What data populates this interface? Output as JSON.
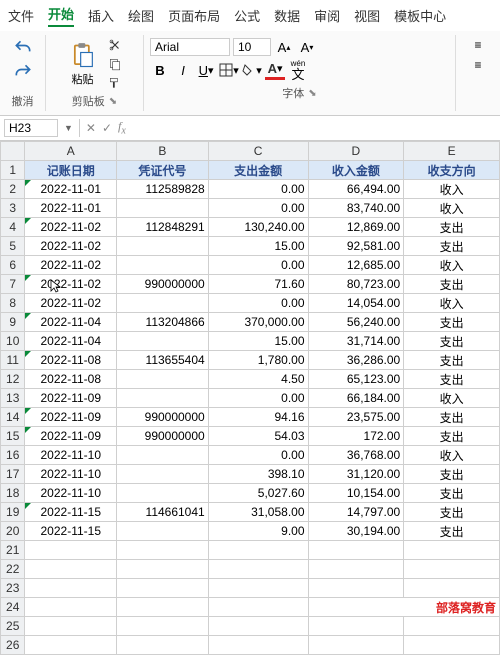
{
  "menu": {
    "items": [
      "文件",
      "开始",
      "插入",
      "绘图",
      "页面布局",
      "公式",
      "数据",
      "审阅",
      "视图",
      "模板中心"
    ],
    "active": 1
  },
  "ribbon": {
    "undo_label": "撤消",
    "clipboard_label": "剪贴板",
    "paste_label": "粘贴",
    "font_label": "字体",
    "font_name": "Arial",
    "font_size": "10",
    "wen_label": "wén",
    "wen_sub": "文"
  },
  "namebox": {
    "ref": "H23"
  },
  "columns": [
    "A",
    "B",
    "C",
    "D",
    "E"
  ],
  "headers": {
    "a": "记账日期",
    "b": "凭证代号",
    "c": "支出金额",
    "d": "收入金额",
    "e": "收支方向"
  },
  "rows": [
    {
      "a": "2022-11-01",
      "b": "112589828",
      "c": "0.00",
      "d": "66,494.00",
      "e": "收入",
      "tri": true
    },
    {
      "a": "2022-11-01",
      "b": "",
      "c": "0.00",
      "d": "83,740.00",
      "e": "收入"
    },
    {
      "a": "2022-11-02",
      "b": "112848291",
      "c": "130,240.00",
      "d": "12,869.00",
      "e": "支出",
      "tri": true
    },
    {
      "a": "2022-11-02",
      "b": "",
      "c": "15.00",
      "d": "92,581.00",
      "e": "支出"
    },
    {
      "a": "2022-11-02",
      "b": "",
      "c": "0.00",
      "d": "12,685.00",
      "e": "收入"
    },
    {
      "a": "2022-11-02",
      "b": "990000000",
      "c": "71.60",
      "d": "80,723.00",
      "e": "支出",
      "tri": true,
      "cursor": true
    },
    {
      "a": "2022-11-02",
      "b": "",
      "c": "0.00",
      "d": "14,054.00",
      "e": "收入"
    },
    {
      "a": "2022-11-04",
      "b": "113204866",
      "c": "370,000.00",
      "d": "56,240.00",
      "e": "支出",
      "tri": true
    },
    {
      "a": "2022-11-04",
      "b": "",
      "c": "15.00",
      "d": "31,714.00",
      "e": "支出"
    },
    {
      "a": "2022-11-08",
      "b": "113655404",
      "c": "1,780.00",
      "d": "36,286.00",
      "e": "支出",
      "tri": true
    },
    {
      "a": "2022-11-08",
      "b": "",
      "c": "4.50",
      "d": "65,123.00",
      "e": "支出"
    },
    {
      "a": "2022-11-09",
      "b": "",
      "c": "0.00",
      "d": "66,184.00",
      "e": "收入"
    },
    {
      "a": "2022-11-09",
      "b": "990000000",
      "c": "94.16",
      "d": "23,575.00",
      "e": "支出",
      "tri": true
    },
    {
      "a": "2022-11-09",
      "b": "990000000",
      "c": "54.03",
      "d": "172.00",
      "e": "支出",
      "tri": true
    },
    {
      "a": "2022-11-10",
      "b": "",
      "c": "0.00",
      "d": "36,768.00",
      "e": "收入"
    },
    {
      "a": "2022-11-10",
      "b": "",
      "c": "398.10",
      "d": "31,120.00",
      "e": "支出"
    },
    {
      "a": "2022-11-10",
      "b": "",
      "c": "5,027.60",
      "d": "10,154.00",
      "e": "支出"
    },
    {
      "a": "2022-11-15",
      "b": "114661041",
      "c": "31,058.00",
      "d": "14,797.00",
      "e": "支出",
      "tri": true
    },
    {
      "a": "2022-11-15",
      "b": "",
      "c": "9.00",
      "d": "30,194.00",
      "e": "支出"
    }
  ],
  "empty_rows": 6,
  "watermark": "部落窝教育"
}
